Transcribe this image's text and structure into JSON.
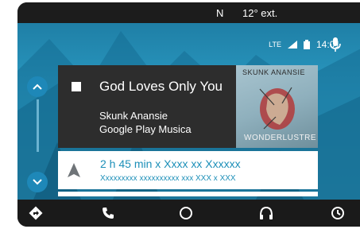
{
  "car_status": {
    "compass": "N",
    "temperature": "12° ext."
  },
  "android_status": {
    "signal": "LTE",
    "time": "14:01"
  },
  "media": {
    "title": "God Loves Only You",
    "artist": "Skunk Anansie",
    "source": "Google Play Musica",
    "album_art": {
      "band_text": "SKUNK ANANSIE",
      "album_text": "WONDERLUSTRE"
    }
  },
  "navigation": {
    "eta": "2 h 45 min x Xxxx xx Xxxxxx",
    "destination": "Xxxxxxxxx xxxxxxxxxx xxx XXX x XXX"
  },
  "bottom_nav": [
    "navigation-icon",
    "phone-icon",
    "home-icon",
    "headphones-icon",
    "exit-icon"
  ]
}
